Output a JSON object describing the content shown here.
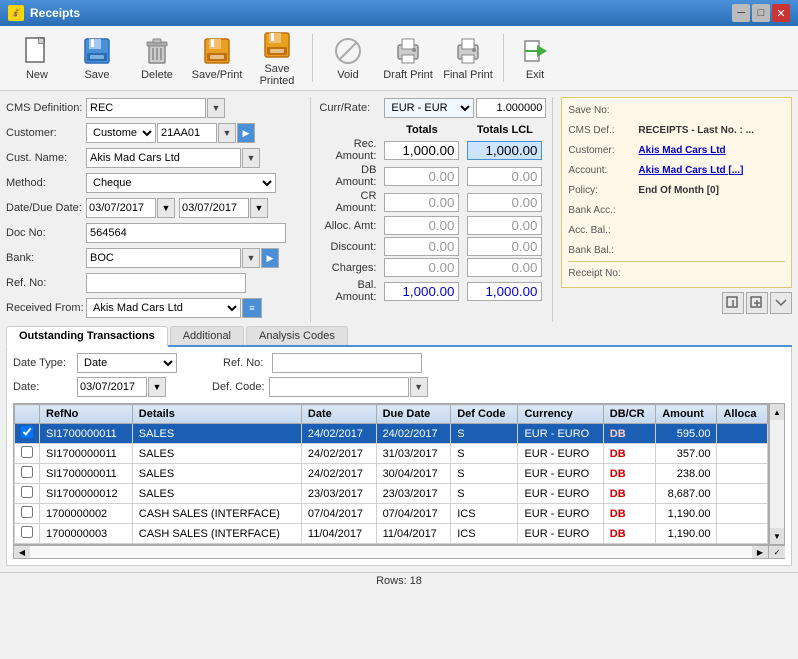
{
  "window": {
    "title": "Receipts",
    "icon": "💰"
  },
  "toolbar": {
    "buttons": [
      {
        "id": "new",
        "label": "New",
        "icon": "📄"
      },
      {
        "id": "save",
        "label": "Save",
        "icon": "💾"
      },
      {
        "id": "delete",
        "label": "Delete",
        "icon": "🗑"
      },
      {
        "id": "save-print",
        "label": "Save/Print",
        "icon": "💾"
      },
      {
        "id": "save-printed",
        "label": "Save Printed",
        "icon": "💾"
      },
      {
        "id": "void",
        "label": "Void",
        "icon": "⊘"
      },
      {
        "id": "draft-print",
        "label": "Draft Print",
        "icon": "🖨"
      },
      {
        "id": "final-print",
        "label": "Final Print",
        "icon": "🖨"
      },
      {
        "id": "exit",
        "label": "Exit",
        "icon": "🚪"
      }
    ]
  },
  "form": {
    "cms_def_label": "CMS Definition:",
    "cms_def_value": "REC",
    "curr_rate_label": "Curr/Rate:",
    "curr_rate_value": "EUR - EUR",
    "curr_rate_number": "1.000000",
    "customer_label": "Customer:",
    "customer_type": "Customer",
    "customer_code": "21AA01",
    "cust_name_label": "Cust. Name:",
    "cust_name_value": "Akis Mad Cars Ltd",
    "method_label": "Method:",
    "method_value": "Cheque",
    "date_label": "Date/Due Date:",
    "date_value": "03/07/2017",
    "due_date_value": "03/07/2017",
    "doc_no_label": "Doc No:",
    "doc_no_value": "564564",
    "bank_label": "Bank:",
    "bank_value": "BOC",
    "ref_no_label": "Ref. No:",
    "ref_no_value": "",
    "received_from_label": "Received From:",
    "received_from_value": "Akis Mad Cars Ltd",
    "totals": {
      "header_totals": "Totals",
      "header_totals_lcl": "Totals LCL",
      "rec_amount_label": "Rec. Amount:",
      "rec_amount": "1,000.00",
      "rec_amount_lcl": "1,000.00",
      "db_amount_label": "DB Amount:",
      "db_amount": "0.00",
      "db_amount_lcl": "0.00",
      "cr_amount_label": "CR Amount:",
      "cr_amount": "0.00",
      "cr_amount_lcl": "0.00",
      "alloc_amt_label": "Alloc. Amt:",
      "alloc_amt": "0.00",
      "alloc_amt_lcl": "0.00",
      "discount_label": "Discount:",
      "discount": "0.00",
      "discount_lcl": "0.00",
      "charges_label": "Charges:",
      "charges": "0.00",
      "charges_lcl": "0.00",
      "bal_amount_label": "Bal. Amount:",
      "bal_amount": "1,000.00",
      "bal_amount_lcl": "1,000.00"
    },
    "info_panel": {
      "save_no_label": "Save No:",
      "save_no_value": "",
      "cms_def_label": "CMS Def.:",
      "cms_def_value": "RECEIPTS - Last No. : ...",
      "customer_label": "Customer:",
      "customer_value": "Akis Mad Cars Ltd",
      "account_label": "Account:",
      "account_value": "Akis Mad Cars Ltd [...]",
      "policy_label": "Policy:",
      "policy_value": "End Of Month [0]",
      "bank_acc_label": "Bank Acc.:",
      "bank_acc_value": "",
      "acc_bal_label": "Acc. Bal.:",
      "acc_bal_value": "",
      "bank_bal_label": "Bank Bal.:",
      "bank_bal_value": "",
      "receipt_no_label": "Receipt No:",
      "receipt_no_value": ""
    }
  },
  "tabs": {
    "active": "outstanding",
    "items": [
      {
        "id": "outstanding",
        "label": "Outstanding Transactions"
      },
      {
        "id": "additional",
        "label": "Additional"
      },
      {
        "id": "analysis",
        "label": "Analysis Codes"
      }
    ]
  },
  "outstanding_tab": {
    "date_type_label": "Date Type:",
    "date_type_value": "Date",
    "ref_no_label": "Ref. No:",
    "ref_no_value": "",
    "date_label": "Date:",
    "date_value": "03/07/2017",
    "def_code_label": "Def. Code:",
    "def_code_value": "",
    "table": {
      "columns": [
        "",
        "RefNo",
        "Details",
        "Date",
        "Due Date",
        "Def Code",
        "Currency",
        "DB/CR",
        "Amount",
        "Alloca"
      ],
      "rows": [
        {
          "checked": true,
          "refno": "SI1700000011",
          "details": "SALES",
          "date": "24/02/2017",
          "due_date": "24/02/2017",
          "def_code": "S",
          "currency": "EUR - EURO",
          "dbcr": "DB",
          "amount": "595.00",
          "alloca": "",
          "selected": true
        },
        {
          "checked": false,
          "refno": "SI1700000011",
          "details": "SALES",
          "date": "24/02/2017",
          "due_date": "31/03/2017",
          "def_code": "S",
          "currency": "EUR - EURO",
          "dbcr": "DB",
          "amount": "357.00",
          "alloca": "",
          "selected": false
        },
        {
          "checked": false,
          "refno": "SI1700000011",
          "details": "SALES",
          "date": "24/02/2017",
          "due_date": "30/04/2017",
          "def_code": "S",
          "currency": "EUR - EURO",
          "dbcr": "DB",
          "amount": "238.00",
          "alloca": "",
          "selected": false
        },
        {
          "checked": false,
          "refno": "SI1700000012",
          "details": "SALES",
          "date": "23/03/2017",
          "due_date": "23/03/2017",
          "def_code": "S",
          "currency": "EUR - EURO",
          "dbcr": "DB",
          "amount": "8,687.00",
          "alloca": "",
          "selected": false
        },
        {
          "checked": false,
          "refno": "1700000002",
          "details": "CASH SALES (INTERFACE)",
          "date": "07/04/2017",
          "due_date": "07/04/2017",
          "def_code": "ICS",
          "currency": "EUR - EURO",
          "dbcr": "DB",
          "amount": "1,190.00",
          "alloca": "",
          "selected": false
        },
        {
          "checked": false,
          "refno": "1700000003",
          "details": "CASH SALES (INTERFACE)",
          "date": "11/04/2017",
          "due_date": "11/04/2017",
          "def_code": "ICS",
          "currency": "EUR - EURO",
          "dbcr": "DB",
          "amount": "1,190.00",
          "alloca": "",
          "selected": false
        }
      ]
    }
  },
  "status_bar": {
    "rows_label": "Rows: 18"
  }
}
